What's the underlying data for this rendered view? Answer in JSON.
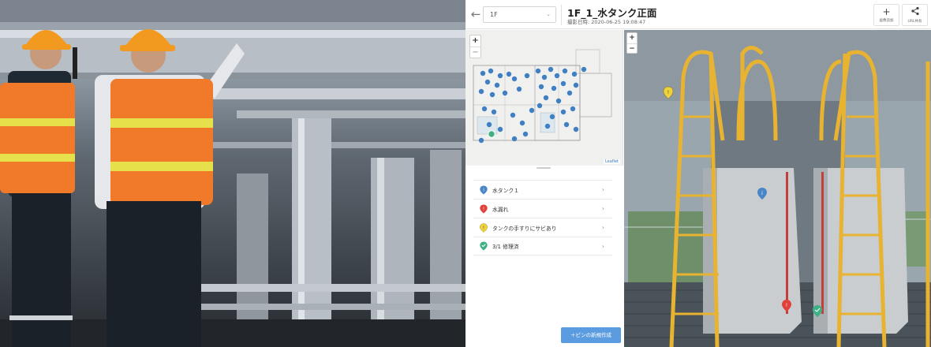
{
  "app": {
    "floor_select": {
      "value": "1F",
      "caret": "⌄"
    },
    "back_glyph": "←",
    "title": "1F_1_水タンク正面",
    "subtitle": "撮影日時: 2020-06-25 19:08:47",
    "actions": [
      {
        "icon": "+",
        "label": "画像追加"
      },
      {
        "icon": "share",
        "label": "URL共有"
      }
    ],
    "map": {
      "zoom_in": "+",
      "zoom_out": "−",
      "attribution": "Leaflet"
    },
    "pins": [
      {
        "label": "水タンク１",
        "icon": "info-pin-icon",
        "color": "#4a86c5",
        "glyph": "i"
      },
      {
        "label": "水漏れ",
        "icon": "alert-pin-icon",
        "color": "#e0413a",
        "glyph": "!"
      },
      {
        "label": "タンクの手すりにサビあり",
        "icon": "warning-pin-icon",
        "color": "#f0d33b",
        "glyph": "!"
      },
      {
        "label": "3/1 修理済",
        "icon": "check-pin-icon",
        "color": "#3fb083",
        "glyph": "✓"
      }
    ],
    "pin_chevron": "›",
    "new_pin_button": "＋ピンの新規作成",
    "pano": {
      "zoom_in": "+",
      "zoom_out": "−"
    }
  },
  "colors": {
    "accent": "#5b9bdf",
    "map_pin": "#3f7fc3",
    "map_pin_active": "#40b07f",
    "railing": "#e8b330"
  }
}
